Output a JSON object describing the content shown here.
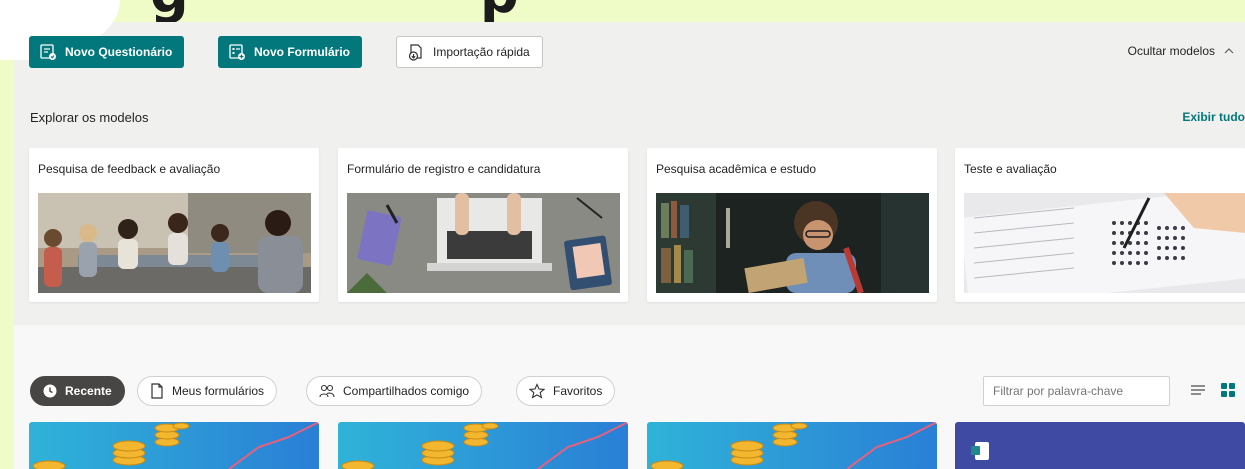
{
  "toolbar": {
    "new_quiz": "Novo Questionário",
    "new_form": "Novo Formulário",
    "quick_import": "Importação rápida",
    "hide_models": "Ocultar modelos"
  },
  "templates": {
    "section_title": "Explorar os modelos",
    "show_all": "Exibir tudo",
    "cards": [
      {
        "title": "Pesquisa de feedback e avaliação"
      },
      {
        "title": "Formulário de registro e candidatura"
      },
      {
        "title": "Pesquisa acadêmica e estudo"
      },
      {
        "title": "Teste e avaliação"
      }
    ]
  },
  "filters": {
    "tabs": [
      "Recente",
      "Meus formulários",
      "Compartilhados comigo",
      "Favoritos"
    ],
    "active_tab": "Recente",
    "search_placeholder": "Filtrar por palavra-chave"
  },
  "colors": {
    "accent": "#03787c",
    "banner": "#effcc8",
    "active_pill": "#484644"
  }
}
